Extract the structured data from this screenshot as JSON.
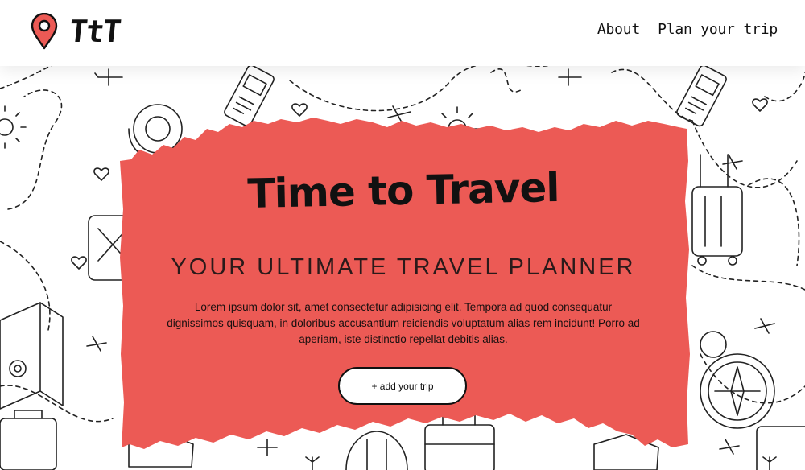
{
  "colors": {
    "accent": "#ec5a55",
    "text": "#111111",
    "background": "#ffffff"
  },
  "header": {
    "logo_text": "TtT",
    "logo_icon": "map-pin-icon",
    "nav": [
      {
        "label": "About"
      },
      {
        "label": "Plan your trip"
      }
    ]
  },
  "hero": {
    "title": "Time to Travel",
    "subtitle": "YOUR ULTIMATE TRAVEL PLANNER",
    "description": "Lorem ipsum dolor sit, amet consectetur adipisicing elit. Tempora ad quod consequatur dignissimos quisquam, in doloribus accusantium reiciendis voluptatum alias rem incidunt! Porro ad aperiam, iste distinctio repellat debitis alias.",
    "button_label": "+ add your trip"
  },
  "background": {
    "pattern": "travel-doodles",
    "icons": [
      "airplane-icon",
      "heart-icon",
      "sun-icon",
      "suitcase-icon",
      "ticket-icon",
      "compass-icon",
      "map-icon",
      "life-ring-icon",
      "shoe-icon",
      "hot-air-balloon-icon",
      "palm-icon"
    ]
  }
}
